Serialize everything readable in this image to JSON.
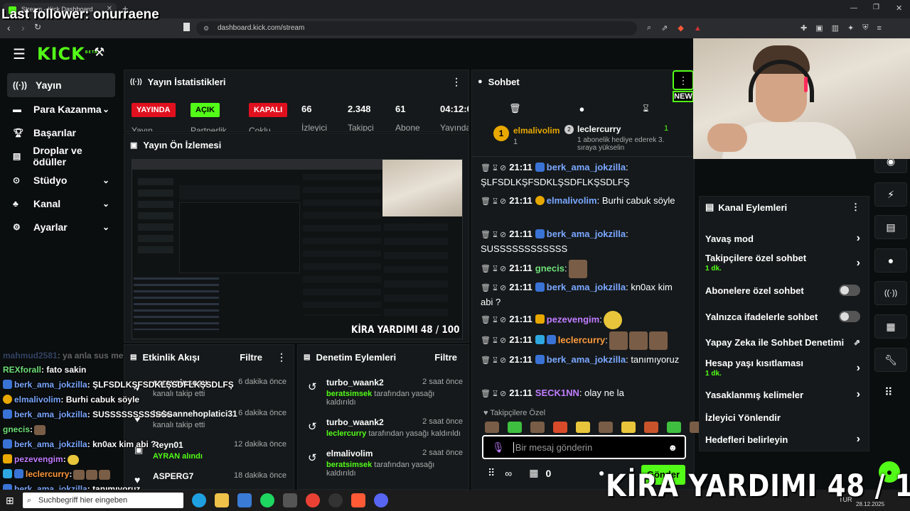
{
  "browser": {
    "tab_title": "Stream - Kick Dashboard",
    "url": "dashboard.kick.com/stream",
    "add_tab": "+"
  },
  "overlay": {
    "last_follower": "Last follower: onurraene",
    "goal": "KİRA YARDIMI  48 / 100"
  },
  "sidebar": {
    "logo": "KICK",
    "logo_sup": "BETA",
    "items": [
      {
        "label": "Yayın",
        "icon": "broadcast-icon",
        "chevron": false
      },
      {
        "label": "Para Kazanma",
        "icon": "money-icon",
        "chevron": true
      },
      {
        "label": "Başarılar",
        "icon": "trophy-icon",
        "chevron": false
      },
      {
        "label": "Droplar ve ödüller",
        "icon": "gift-icon",
        "chevron": false
      },
      {
        "label": "Stüdyo",
        "icon": "studio-icon",
        "chevron": true
      },
      {
        "label": "Kanal",
        "icon": "channel-icon",
        "chevron": true
      },
      {
        "label": "Ayarlar",
        "icon": "gear-icon",
        "chevron": true
      }
    ]
  },
  "stats": {
    "title": "Yayın İstatistikleri",
    "badges": [
      "YAYINDA",
      "AÇIK",
      "KAPALI"
    ],
    "badge_labels": [
      "Yayın",
      "Partnerlik",
      "Çoklu"
    ],
    "values": [
      "66",
      "2.348",
      "61",
      "04:12:0"
    ],
    "value_labels": [
      "İzleyici",
      "Takipçi",
      "Abone",
      "Yayında"
    ]
  },
  "preview": {
    "title": "Yayın Ön İzlemesi"
  },
  "activity": {
    "title": "Etkinlik Akışı",
    "filter": "Filtre",
    "items": [
      {
        "user": "saraysinsosu",
        "text": "kanalı takip etti",
        "time": "6 dakika önce"
      },
      {
        "user": "babaannehoplatici31",
        "text": "kanalı takip etti",
        "time": "6 dakika önce"
      },
      {
        "user": "Reyn01",
        "text": "AYRAN alındı",
        "time": "12 dakika önce"
      },
      {
        "user": "ASPERG7",
        "text": "",
        "time": "18 dakika önce"
      }
    ]
  },
  "moderation": {
    "title": "Denetim Eylemleri",
    "filter": "Filtre",
    "items": [
      {
        "user": "turbo_waank2",
        "actor": "beratsimsek",
        "text": "tarafından yasağı kaldırıldı",
        "time": "2 saat önce"
      },
      {
        "user": "turbo_waank2",
        "actor": "leclercurry",
        "text": "tarafından yasağı kaldırıldı",
        "time": "2 saat önce"
      },
      {
        "user": "elmalivolim",
        "actor": "beratsimsek",
        "text": "tarafından yasağı kaldırıldı",
        "time": "2 saat önce"
      }
    ]
  },
  "chat": {
    "title": "Sohbet",
    "new_label": "NEW",
    "pinned_user": "elmalivolim",
    "pinned_count": "1",
    "gift_user": "leclercurry",
    "gift_count": "1",
    "gift_text": "1 abonelik hediye ederek 3. sıraya yükselin",
    "messages": [
      {
        "time": "21:11",
        "user": "berk_ama_jokzilla",
        "color": "#7aa7ff",
        "text": ": ŞLFSDLKŞFSDKLŞSDFLKŞSDLFŞ"
      },
      {
        "time": "21:11",
        "user": "elmalivolim",
        "color": "#7aa7ff",
        "text": ": Burhi cabuk söyle"
      },
      {
        "time": "21:11",
        "user": "berk_ama_jokzilla",
        "color": "#7aa7ff",
        "text": ": SUSSSSSSSSSSSS"
      },
      {
        "time": "21:11",
        "user": "gnecis",
        "color": "#6fe07a",
        "text": ":"
      },
      {
        "time": "21:11",
        "user": "berk_ama_jokzilla",
        "color": "#7aa7ff",
        "text": ": kn0ax kim abi ?"
      },
      {
        "time": "21:11",
        "user": "pezevengim",
        "color": "#c07dff",
        "text": ":"
      },
      {
        "time": "21:11",
        "user": "leclercurry",
        "color": "#ff9b3d",
        "text": ":"
      },
      {
        "time": "21:11",
        "user": "berk_ama_jokzilla",
        "color": "#7aa7ff",
        "text": ": tanımıyoruz"
      },
      {
        "time": "21:11",
        "user": "SECK1NN",
        "color": "#c07dff",
        "text": ": olay ne la"
      }
    ],
    "follower_emotes": "Takipçilere Özel",
    "input_placeholder": "Bir mesaj gönderin",
    "points": "0",
    "send": "Gönder"
  },
  "channel_actions": {
    "title": "Kanal Eylemleri",
    "items": [
      {
        "label": "Yavaş mod",
        "sub": "",
        "control": "arrow"
      },
      {
        "label": "Takipçilere özel sohbet",
        "sub": "1 dk.",
        "control": "arrow"
      },
      {
        "label": "Abonelere özel sohbet",
        "sub": "",
        "control": "toggle"
      },
      {
        "label": "Yalnızca ifadelerle sohbet",
        "sub": "",
        "control": "toggle"
      },
      {
        "label": "Yapay Zeka ile Sohbet Denetimi",
        "sub": "",
        "control": "external"
      },
      {
        "label": "Hesap yaşı kısıtlaması",
        "sub": "1 dk.",
        "control": "arrow"
      },
      {
        "label": "Yasaklanmış kelimeler",
        "sub": "",
        "control": "arrow"
      },
      {
        "label": "İzleyici Yönlendir",
        "sub": "",
        "control": "none"
      },
      {
        "label": "Hedefleri belirleyin",
        "sub": "",
        "control": "arrow"
      }
    ]
  },
  "overlay_chat": [
    {
      "user": "mahmud2581",
      "text": ": ya anla sus me",
      "color": "#7aa7ff"
    },
    {
      "user": "REXforall",
      "text": ": fato sakin",
      "color": "#6fe07a"
    },
    {
      "user": "berk_ama_jokzilla",
      "text": ": ŞLFSDLKŞFSDKLŞSDFLKŞSDLFŞ",
      "color": "#7aa7ff"
    },
    {
      "user": "elmalivolim",
      "text": ": Burhi cabuk söyle",
      "color": "#7aa7ff"
    },
    {
      "user": "berk_ama_jokzilla",
      "text": ": SUSSSSSSSSSSSS",
      "color": "#7aa7ff"
    },
    {
      "user": "gnecis",
      "text": ":",
      "color": "#6fe07a"
    },
    {
      "user": "berk_ama_jokzilla",
      "text": ": kn0ax kim abi ?",
      "color": "#7aa7ff"
    },
    {
      "user": "pezevengim",
      "text": ":",
      "color": "#c07dff"
    },
    {
      "user": "leclercurry",
      "text": ":",
      "color": "#ff9b3d"
    },
    {
      "user": "berk_ama_jokzilla",
      "text": ": tanımıyoruz",
      "color": "#7aa7ff"
    },
    {
      "user": "SECK1NN",
      "text": "",
      "color": "#c07dff"
    }
  ],
  "taskbar": {
    "search_placeholder": "Suchbegriff hier eingeben",
    "lang": "TUR",
    "date": "28.12.2025"
  }
}
